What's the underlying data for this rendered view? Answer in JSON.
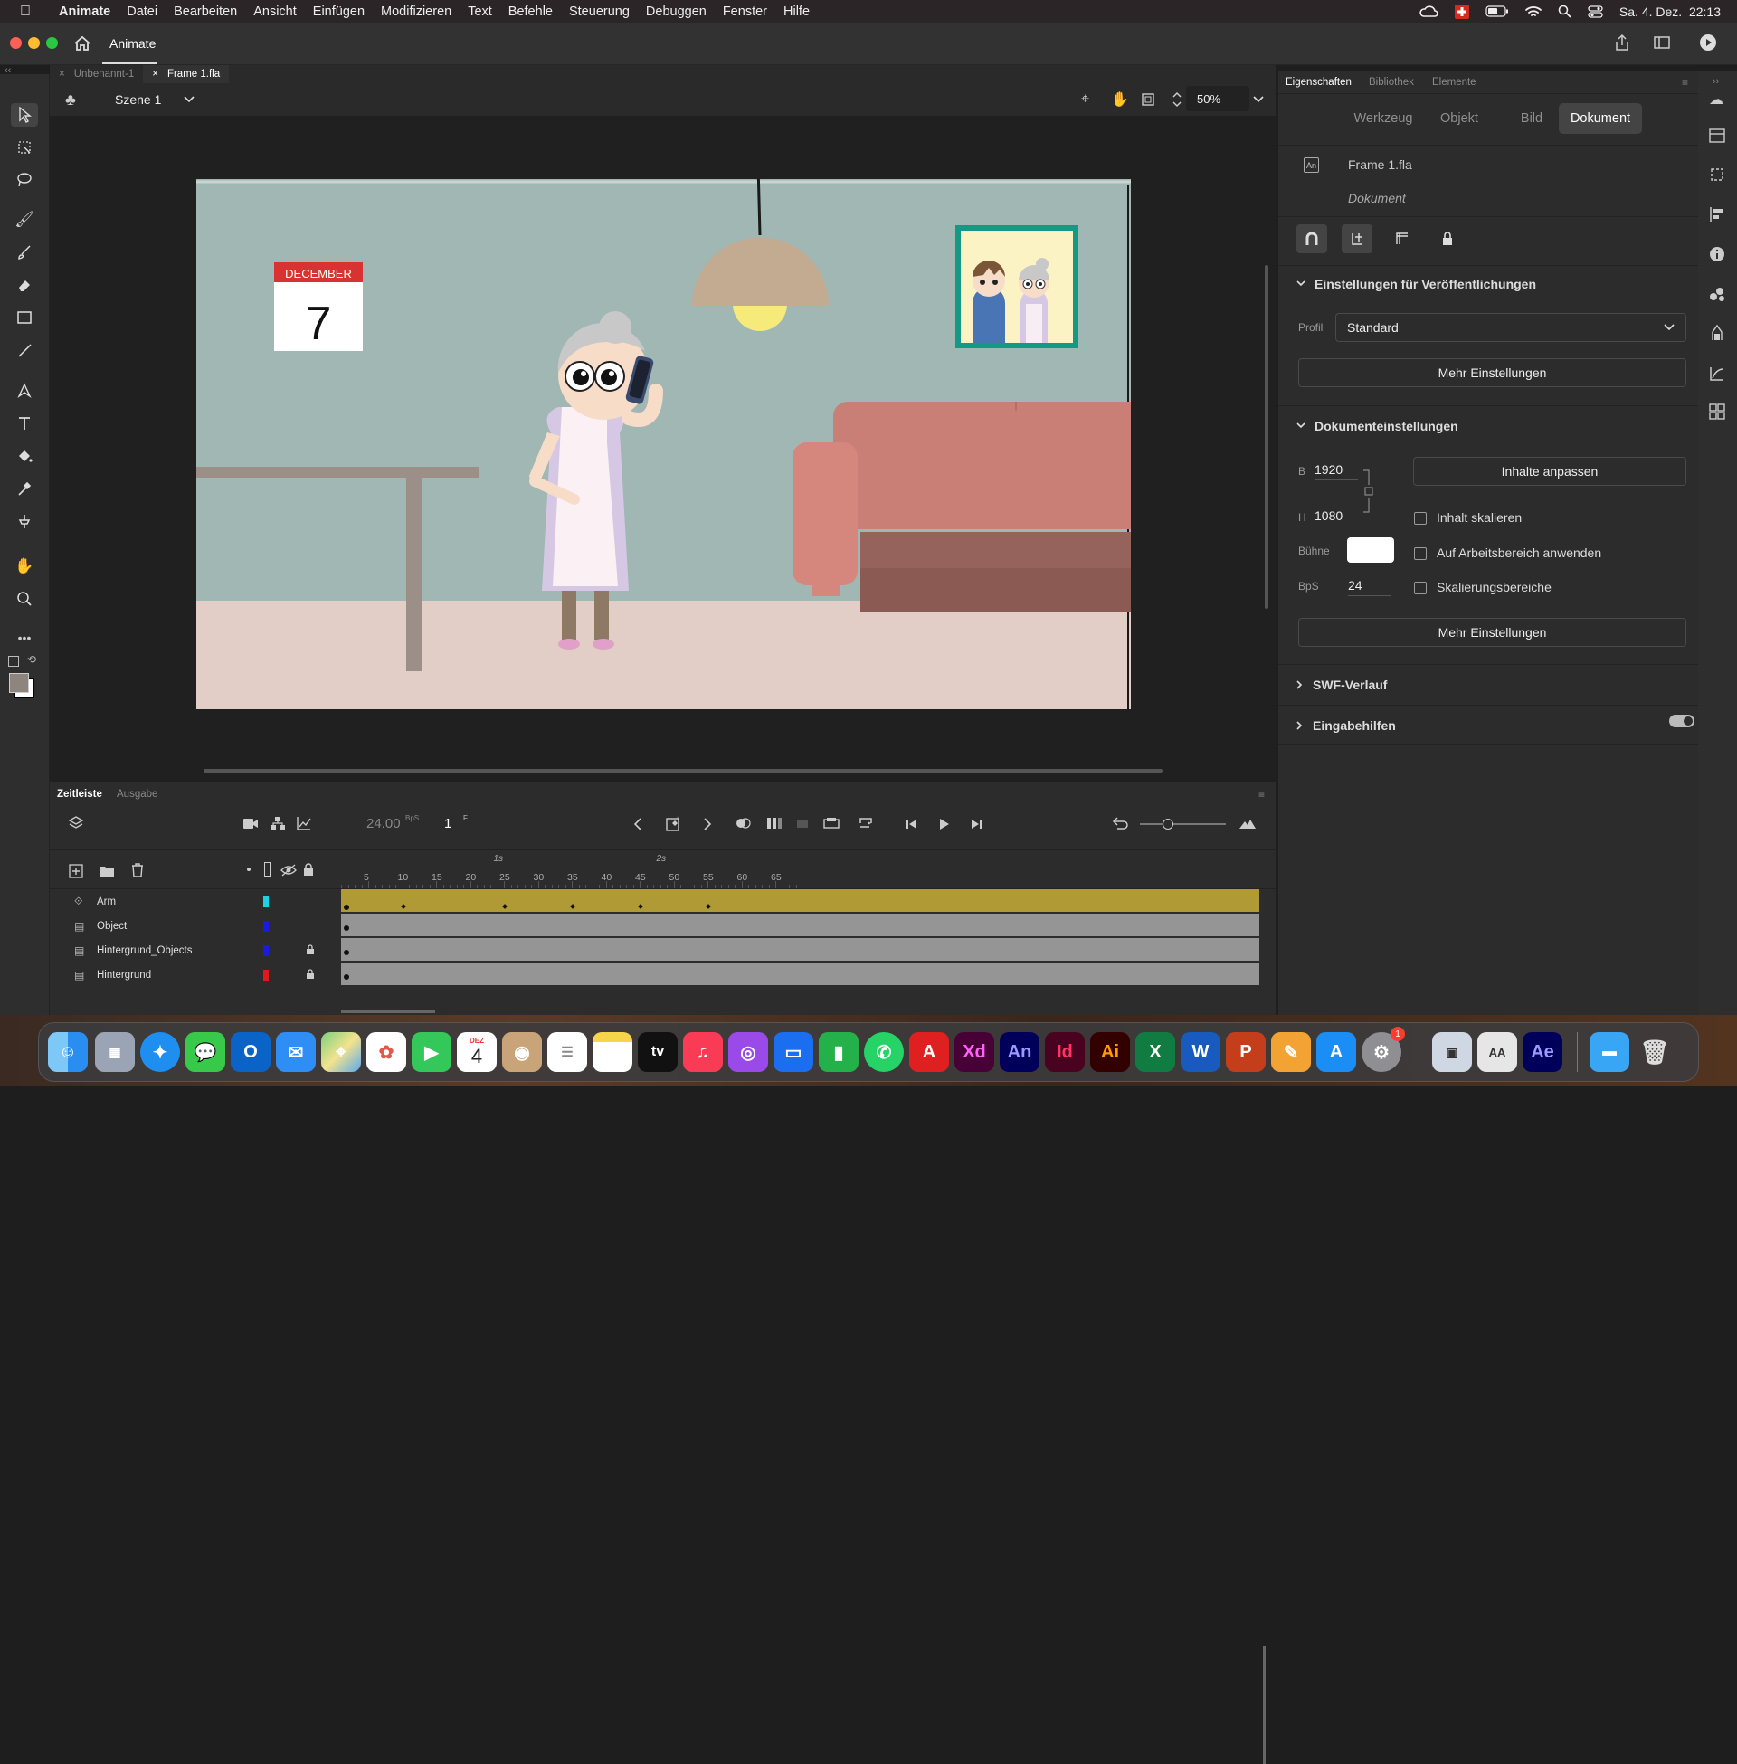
{
  "menubar": {
    "items": [
      "Animate",
      "Datei",
      "Bearbeiten",
      "Ansicht",
      "Einfügen",
      "Modifizieren",
      "Text",
      "Befehle",
      "Steuerung",
      "Debuggen",
      "Fenster",
      "Hilfe"
    ],
    "clock": "Sa. 4. Dez.  22:13"
  },
  "titlebar": {
    "app_label": "Animate"
  },
  "doctabs": [
    {
      "label": "Unbenannt-1",
      "active": false
    },
    {
      "label": "Frame 1.fla",
      "active": true
    }
  ],
  "scene": {
    "label": "Szene 1",
    "zoom": "50%"
  },
  "stage": {
    "calendar_month": "DECEMBER",
    "calendar_day": "7",
    "colors": {
      "wall": "#a0b7b4",
      "floor": "#e2cec6",
      "sofa": "#c97f76",
      "sofa_arm": "#d6877d",
      "frame": "#149a84"
    }
  },
  "properties": {
    "panel_tabs": [
      "Eigenschaften",
      "Bibliothek",
      "Elemente"
    ],
    "segments": [
      "Werkzeug",
      "Objekt",
      "Bild",
      "Dokument"
    ],
    "active_segment": "Dokument",
    "doc_name": "Frame 1.fla",
    "doc_type": "Dokument",
    "doc_icon_label": "An",
    "publish_section": "Einstellungen für Veröffentlichungen",
    "profile_label": "Profil",
    "profile_value": "Standard",
    "more_settings": "Mehr Einstellungen",
    "doc_settings_section": "Dokumenteinstellungen",
    "width_label": "B",
    "width_value": "1920",
    "height_label": "H",
    "height_value": "1080",
    "stage_label": "Bühne",
    "fps_label": "BpS",
    "fps_value": "24",
    "fit_content": "Inhalte anpassen",
    "scale_content": "Inhalt skalieren",
    "apply_workspace": "Auf Arbeitsbereich anwenden",
    "scale_regions": "Skalierungsbereiche",
    "swf_section": "SWF-Verlauf",
    "accessibility_section": "Eingabehilfen"
  },
  "timeline": {
    "tabs": [
      "Zeitleiste",
      "Ausgabe"
    ],
    "fps_display": "24.00",
    "fps_unit": "BpS",
    "current_frame": "1",
    "frame_unit": "F",
    "ruler_seconds": [
      "1s",
      "2s"
    ],
    "ruler_numbers": [
      "5",
      "10",
      "15",
      "20",
      "25",
      "30",
      "35",
      "40",
      "45",
      "50",
      "55",
      "60",
      "65"
    ],
    "layers": [
      {
        "name": "Arm",
        "color": "#1ed2e6",
        "locked": false
      },
      {
        "name": "Object",
        "color": "#1a1ae0",
        "locked": false
      },
      {
        "name": "Hintergrund_Objects",
        "color": "#1a1ae0",
        "locked": true
      },
      {
        "name": "Hintergrund",
        "color": "#e01a1a",
        "locked": true
      }
    ]
  },
  "dock": {
    "calendar_month": "DEZ",
    "calendar_day": "4",
    "appletv_label": "tv",
    "badge": "1",
    "apps": [
      {
        "name": "xd",
        "label": "Xd",
        "bg": "#470137",
        "fg": "#ff61f6"
      },
      {
        "name": "an",
        "label": "An",
        "bg": "#00005b",
        "fg": "#9999ff"
      },
      {
        "name": "id",
        "label": "Id",
        "bg": "#49021f",
        "fg": "#ff3366"
      },
      {
        "name": "ai",
        "label": "Ai",
        "bg": "#330000",
        "fg": "#ff9a00"
      },
      {
        "name": "ae",
        "label": "Ae",
        "bg": "#00005b",
        "fg": "#9999ff"
      }
    ]
  }
}
